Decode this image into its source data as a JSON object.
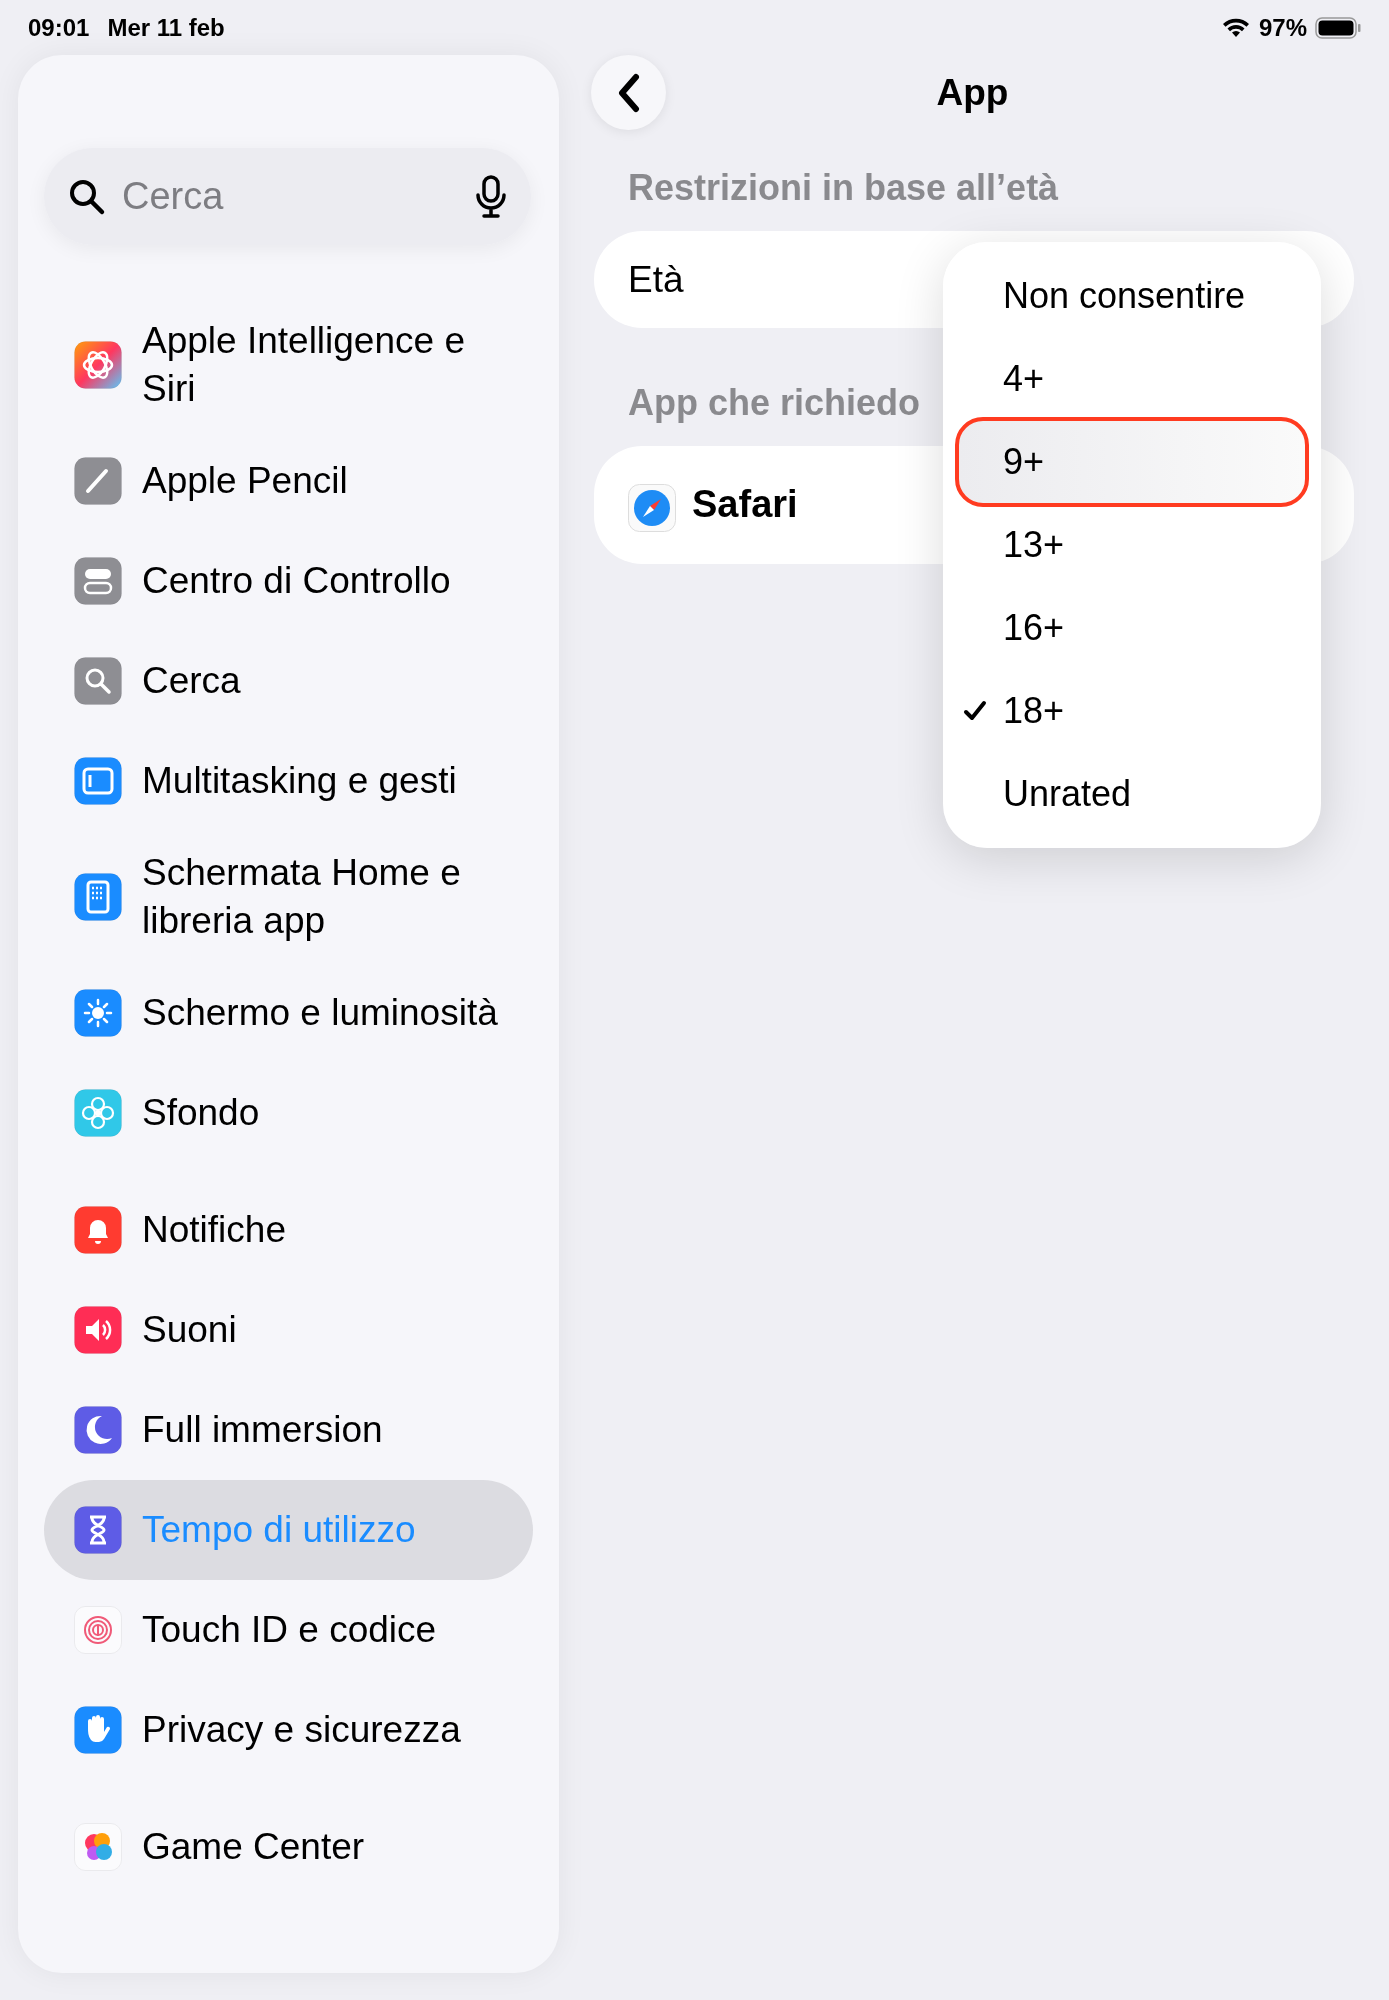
{
  "status_bar": {
    "time": "09:01",
    "date": "Mer 11 feb",
    "battery": "97%"
  },
  "sidebar": {
    "search": {
      "placeholder": "Cerca"
    },
    "groups": [
      [
        {
          "label": "Apple Intelligence e Siri",
          "selected": false
        },
        {
          "label": "Apple Pencil",
          "selected": false
        },
        {
          "label": "Centro di Controllo",
          "selected": false
        },
        {
          "label": "Cerca",
          "selected": false
        },
        {
          "label": "Multitasking e gesti",
          "selected": false
        },
        {
          "label": "Schermata Home e libreria app",
          "selected": false
        },
        {
          "label": "Schermo e luminosità",
          "selected": false
        },
        {
          "label": "Sfondo",
          "selected": false
        }
      ],
      [
        {
          "label": "Notifiche",
          "selected": false
        },
        {
          "label": "Suoni",
          "selected": false
        },
        {
          "label": "Full immersion",
          "selected": false
        },
        {
          "label": "Tempo di utilizzo",
          "selected": true
        },
        {
          "label": "Touch ID e codice",
          "selected": false
        },
        {
          "label": "Privacy e sicurezza",
          "selected": false
        }
      ],
      [
        {
          "label": "Game Center",
          "selected": false
        }
      ]
    ]
  },
  "detail": {
    "title": "App",
    "sections": [
      {
        "header": "Restrizioni in base all’età",
        "rows": [
          {
            "label": "Età",
            "kind": "plain"
          }
        ]
      },
      {
        "header": "App che richiedo",
        "rows": [
          {
            "label": "Safari",
            "kind": "app"
          }
        ]
      }
    ]
  },
  "menu": [
    {
      "label": "Non consentire",
      "selected": false,
      "highlighted": false
    },
    {
      "label": "4+",
      "selected": false,
      "highlighted": false
    },
    {
      "label": "9+",
      "selected": false,
      "highlighted": true
    },
    {
      "label": "13+",
      "selected": false,
      "highlighted": false
    },
    {
      "label": "16+",
      "selected": false,
      "highlighted": false
    },
    {
      "label": "18+",
      "selected": true,
      "highlighted": false
    },
    {
      "label": "Unrated",
      "selected": false,
      "highlighted": false
    }
  ]
}
